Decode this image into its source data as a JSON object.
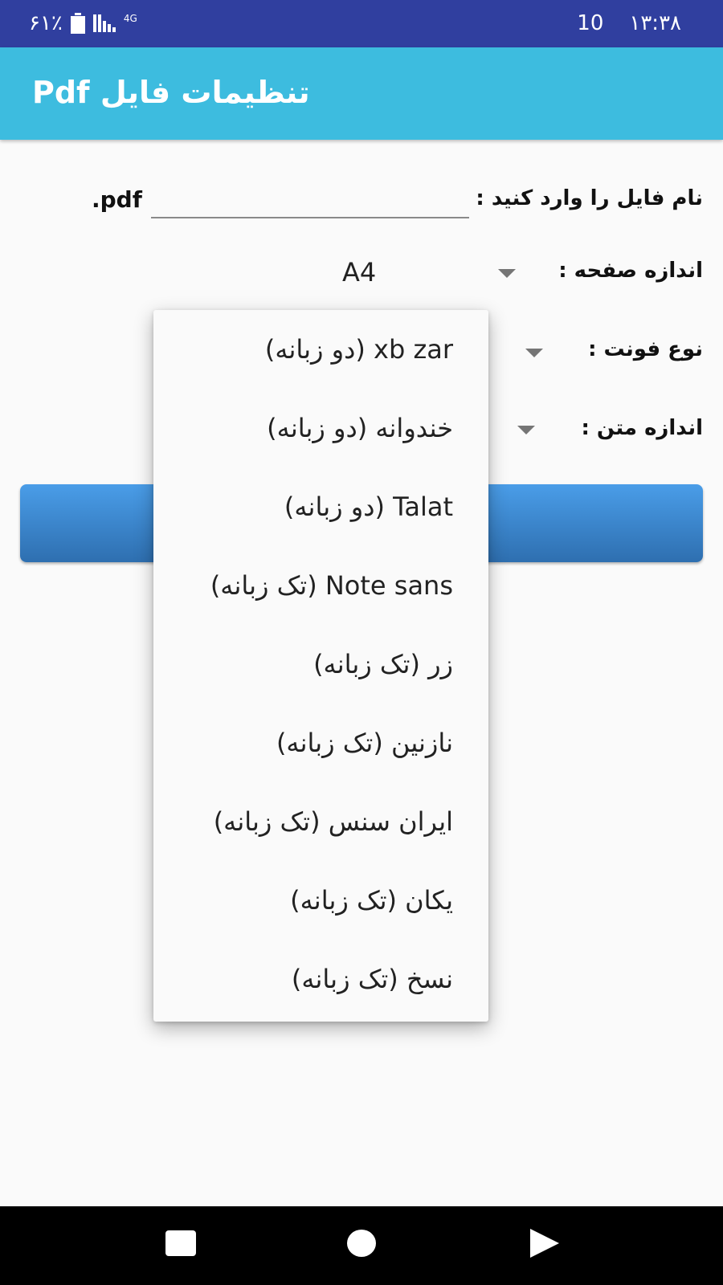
{
  "status_bar": {
    "battery": "۶۱٪",
    "network": "4G",
    "notification_count": "10",
    "time": "۱۳:۳۸"
  },
  "app_bar": {
    "title": "تنظیمات فایل Pdf"
  },
  "form": {
    "filename_label": "نام فایل را وارد کنید :",
    "filename_value": "",
    "filename_extension": ".pdf",
    "page_size_label": "اندازه صفحه :",
    "page_size_value": "A4",
    "font_type_label": "نوع فونت :",
    "text_size_label": "اندازه متن :"
  },
  "font_dropdown": {
    "options": [
      "xb zar (دو زبانه)",
      "خندوانه (دو زبانه)",
      "Talat (دو زبانه)",
      "Note sans (تک زبانه)",
      "زر (تک زبانه)",
      "نازنین (تک زبانه)",
      "ایران سنس (تک زبانه)",
      "یکان (تک زبانه)",
      "نسخ (تک زبانه)"
    ]
  },
  "colors": {
    "status_bar": "#303f9f",
    "app_bar": "#3dbcdf",
    "button_top": "#4a9de8",
    "button_bottom": "#2e6fb0"
  },
  "icons": {
    "battery": "battery-icon",
    "signal": "signal-icon",
    "dropdown_caret": "caret-down-icon",
    "nav_back": "nav-square-icon",
    "nav_home": "nav-circle-icon",
    "nav_recent": "nav-triangle-icon"
  }
}
